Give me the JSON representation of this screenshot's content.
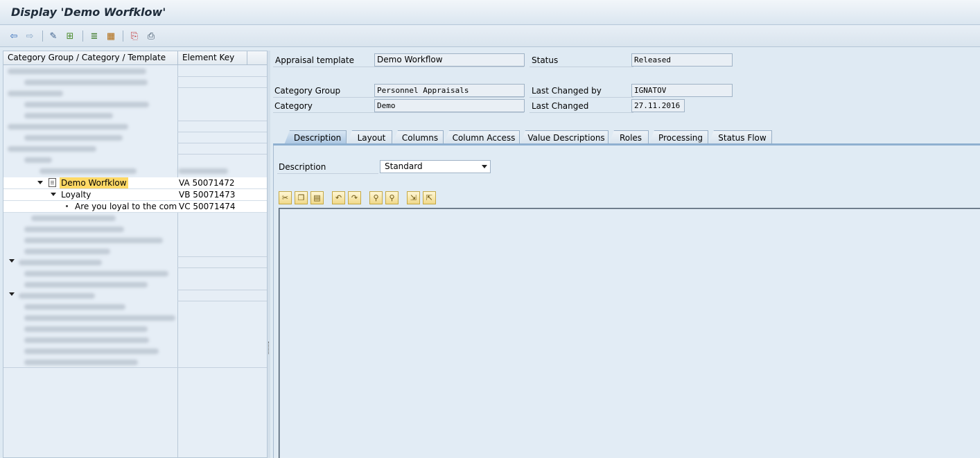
{
  "window": {
    "title": "Display 'Demo Worfklow'"
  },
  "toolbar": {
    "icons": [
      "back-arrow-icon",
      "forward-arrow-icon",
      "edit-glasses-icon",
      "hierarchy-icon",
      "stack-icon",
      "org-chart-icon",
      "pdf-icon",
      "print-preview-icon"
    ]
  },
  "tree": {
    "columns": [
      "Category Group / Category / Template",
      "Element Key"
    ],
    "rows": [
      {
        "label": "Demo Worfklow",
        "key": "VA 50071472",
        "level": 2,
        "expanded": true,
        "selected": true
      },
      {
        "label": "Loyalty",
        "key": "VB 50071473",
        "level": 3,
        "expanded": true
      },
      {
        "label": "Are you loyal to the company?",
        "key": "VC 50071474",
        "level": 4
      }
    ]
  },
  "details": {
    "appraisal_template_label": "Appraisal template",
    "appraisal_template_value": "Demo Workflow",
    "status_label": "Status",
    "status_value": "Released",
    "category_group_label": "Category Group",
    "category_group_value": "Personnel Appraisals",
    "last_changed_by_label": "Last Changed by",
    "last_changed_by_value": "IGNATOV",
    "category_label": "Category",
    "category_value": "Demo",
    "last_changed_label": "Last Changed",
    "last_changed_value": "27.11.2016"
  },
  "tabs": [
    {
      "label": "Description",
      "active": true
    },
    {
      "label": "Layout"
    },
    {
      "label": "Columns"
    },
    {
      "label": "Column Access"
    },
    {
      "label": "Value Descriptions"
    },
    {
      "label": "Roles"
    },
    {
      "label": "Processing"
    },
    {
      "label": "Status Flow"
    }
  ],
  "description": {
    "label": "Description",
    "selected": "Standard"
  },
  "editor_toolbar": {
    "icons": [
      "cut-icon",
      "copy-icon",
      "paste-icon",
      "undo-icon",
      "redo-icon",
      "find-icon",
      "find-next-icon",
      "import-icon",
      "export-icon"
    ]
  }
}
